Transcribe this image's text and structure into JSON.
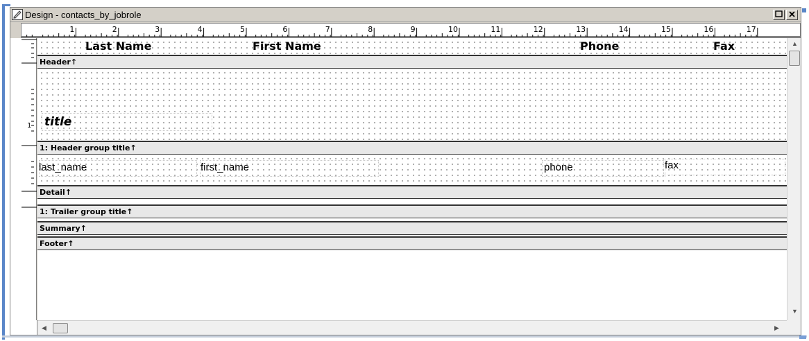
{
  "window": {
    "title": "Design - contacts_by_jobrole",
    "restore_glyph": "□",
    "close_glyph": "×"
  },
  "ruler": {
    "numbers": [
      "1",
      "2",
      "3",
      "4",
      "5",
      "6",
      "7",
      "8",
      "9",
      "10",
      "11",
      "12",
      "13",
      "14",
      "15",
      "16",
      "17"
    ]
  },
  "vruler": {
    "mark": "1"
  },
  "headings": {
    "last_name": "Last Name",
    "first_name": "First Name",
    "phone": "Phone",
    "fax": "Fax"
  },
  "bands": {
    "header": "Header↑",
    "header_group": "1: Header group title↑",
    "detail": "Detail↑",
    "trailer_group": "1: Trailer group title↑",
    "summary": "Summary↑",
    "footer": "Footer↑"
  },
  "fields": {
    "title": "title",
    "last_name": "last_name",
    "first_name": "first_name",
    "phone": "phone",
    "fax": "fax"
  },
  "icons": {
    "window_icon": "design-window-icon",
    "scroll_up": "up-arrow-icon",
    "scroll_down": "down-arrow-icon",
    "scroll_left": "left-arrow-icon",
    "scroll_right": "right-arrow-icon"
  },
  "colors": {
    "window_frame": "#d4d0c8",
    "accent": "#5a86c8",
    "band_bar": "#e8e8e8"
  }
}
